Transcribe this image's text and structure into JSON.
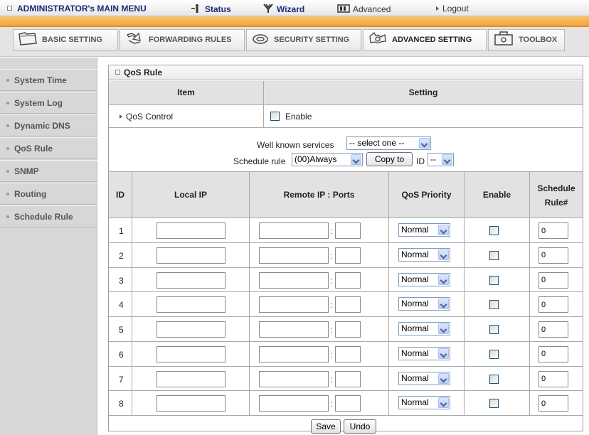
{
  "topbar": {
    "admin_menu": "ADMINISTRATOR's MAIN MENU",
    "status": "Status",
    "wizard": "Wizard",
    "advanced": "Advanced",
    "logout": "Logout"
  },
  "tabs": [
    {
      "label": "BASIC SETTING",
      "icon": "folder-icon"
    },
    {
      "label": "FORWARDING RULES",
      "icon": "arrows-icon"
    },
    {
      "label": "SECURITY SETTING",
      "icon": "lock-icon"
    },
    {
      "label": "ADVANCED SETTING",
      "icon": "gear-icon"
    },
    {
      "label": "TOOLBOX",
      "icon": "toolbox-icon"
    }
  ],
  "sidebar": {
    "items": [
      {
        "label": "System Time"
      },
      {
        "label": "System Log"
      },
      {
        "label": "Dynamic DNS"
      },
      {
        "label": "QoS Rule"
      },
      {
        "label": "SNMP"
      },
      {
        "label": "Routing"
      },
      {
        "label": "Schedule Rule"
      }
    ]
  },
  "main": {
    "title": "QoS Rule",
    "col_item": "Item",
    "col_setting": "Setting",
    "qos_control_label": "QoS Control",
    "enable_label": "Enable",
    "qos_control_checked": false,
    "well_known_label": "Well known services",
    "well_known_value": "-- select one --",
    "schedule_rule_label": "Schedule rule",
    "schedule_rule_value": "(00)Always",
    "copy_to_label": "Copy to",
    "id_label": "ID",
    "id_value": "--",
    "table_headers": {
      "id": "ID",
      "local_ip": "Local IP",
      "remote": "Remote IP : Ports",
      "priority": "QoS Priority",
      "enable": "Enable",
      "schedule_line1": "Schedule",
      "schedule_line2": "Rule#"
    },
    "rows": [
      {
        "id": "1",
        "local_ip": "",
        "remote_ip": "",
        "port": "",
        "priority": "Normal",
        "enabled": false,
        "schedule": "0"
      },
      {
        "id": "2",
        "local_ip": "",
        "remote_ip": "",
        "port": "",
        "priority": "Normal",
        "enabled": false,
        "schedule": "0"
      },
      {
        "id": "3",
        "local_ip": "",
        "remote_ip": "",
        "port": "",
        "priority": "Normal",
        "enabled": false,
        "schedule": "0"
      },
      {
        "id": "4",
        "local_ip": "",
        "remote_ip": "",
        "port": "",
        "priority": "Normal",
        "enabled": false,
        "schedule": "0"
      },
      {
        "id": "5",
        "local_ip": "",
        "remote_ip": "",
        "port": "",
        "priority": "Normal",
        "enabled": false,
        "schedule": "0"
      },
      {
        "id": "6",
        "local_ip": "",
        "remote_ip": "",
        "port": "",
        "priority": "Normal",
        "enabled": false,
        "schedule": "0"
      },
      {
        "id": "7",
        "local_ip": "",
        "remote_ip": "",
        "port": "",
        "priority": "Normal",
        "enabled": false,
        "schedule": "0"
      },
      {
        "id": "8",
        "local_ip": "",
        "remote_ip": "",
        "port": "",
        "priority": "Normal",
        "enabled": false,
        "schedule": "0"
      }
    ],
    "colon": ":",
    "save_label": "Save",
    "undo_label": "Undo"
  },
  "colors": {
    "accent_orange": "#f3a43a",
    "title_blue": "#1f2a7a",
    "sidebar_bg": "#d7d7d7"
  }
}
